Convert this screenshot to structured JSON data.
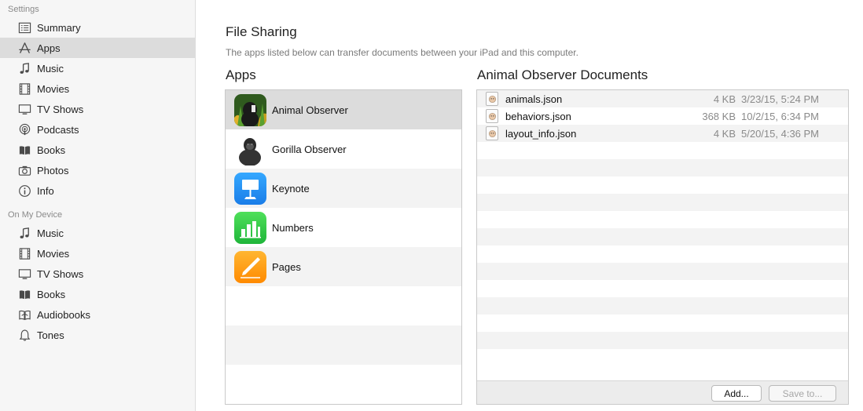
{
  "sidebar": {
    "settings_header": "Settings",
    "settings_items": [
      {
        "label": "Summary",
        "icon": "summary-icon"
      },
      {
        "label": "Apps",
        "icon": "apps-icon",
        "selected": true
      },
      {
        "label": "Music",
        "icon": "music-note-icon"
      },
      {
        "label": "Movies",
        "icon": "film-icon"
      },
      {
        "label": "TV Shows",
        "icon": "tv-icon"
      },
      {
        "label": "Podcasts",
        "icon": "podcast-icon"
      },
      {
        "label": "Books",
        "icon": "book-icon"
      },
      {
        "label": "Photos",
        "icon": "camera-icon"
      },
      {
        "label": "Info",
        "icon": "info-icon"
      }
    ],
    "device_header": "On My Device",
    "device_items": [
      {
        "label": "Music",
        "icon": "music-note-icon"
      },
      {
        "label": "Movies",
        "icon": "film-icon"
      },
      {
        "label": "TV Shows",
        "icon": "tv-icon"
      },
      {
        "label": "Books",
        "icon": "book-icon"
      },
      {
        "label": "Audiobooks",
        "icon": "audiobook-icon"
      },
      {
        "label": "Tones",
        "icon": "bell-icon"
      }
    ]
  },
  "main": {
    "title": "File Sharing",
    "subtitle": "The apps listed below can transfer documents between your iPad and this computer.",
    "apps_heading": "Apps",
    "docs_heading": "Animal Observer Documents",
    "apps": [
      {
        "name": "Animal Observer",
        "icon": "animal-observer-icon",
        "selected": true
      },
      {
        "name": "Gorilla Observer",
        "icon": "gorilla-observer-icon"
      },
      {
        "name": "Keynote",
        "icon": "keynote-icon"
      },
      {
        "name": "Numbers",
        "icon": "numbers-icon"
      },
      {
        "name": "Pages",
        "icon": "pages-icon"
      }
    ],
    "documents": [
      {
        "name": "animals.json",
        "size": "4 KB",
        "date": "3/23/15, 5:24 PM"
      },
      {
        "name": "behaviors.json",
        "size": "368 KB",
        "date": "10/2/15, 6:34 PM"
      },
      {
        "name": "layout_info.json",
        "size": "4 KB",
        "date": "5/20/15, 4:36 PM"
      }
    ],
    "add_button": "Add...",
    "save_button": "Save to..."
  },
  "colors": {
    "sidebar_bg": "#f6f6f6",
    "selected_bg": "#dcdcdc",
    "alt_row_bg": "#f3f3f3",
    "keynote_blue": "#1a8cf0",
    "numbers_green": "#2ecc40",
    "pages_orange": "#ff9a12"
  }
}
